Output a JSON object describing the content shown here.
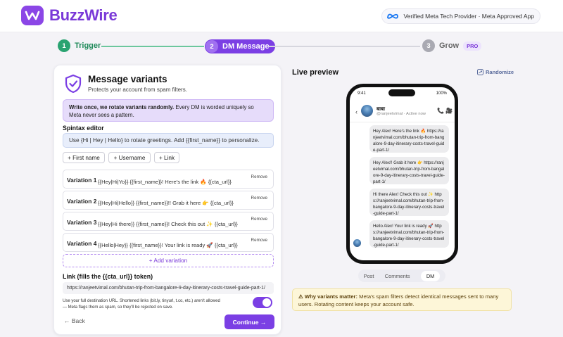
{
  "brand": {
    "name": "BuzzWire",
    "verified_text": "Verified Meta Tech Provider · Meta Approved App"
  },
  "steps": [
    {
      "num": "1",
      "label": "Trigger",
      "state": "done"
    },
    {
      "num": "2",
      "label": "DM Message",
      "state": "active"
    },
    {
      "num": "3",
      "label": "Grow",
      "state": "pending",
      "badge": "PRO"
    }
  ],
  "editor": {
    "title": "Message variants",
    "subtitle": "Protects your account from spam filters.",
    "info_bold": "Write once, we rotate variants randomly.",
    "info_rest": " Every DM is worded uniquely so Meta never sees a pattern.",
    "spintax_label": "Spintax editor",
    "spintax_value": "Use {Hi | Hey | Hello} to rotate greetings. Add {{first_name}} to personalize.",
    "tokens": [
      "+ First name",
      "+ Username",
      "+ Link"
    ],
    "variations": [
      {
        "label": "Variation 1",
        "text": "{{Hey|Hi|Yo}} {{first_name}}! Here's the link 🔥 {{cta_url}}",
        "remove": "Remove"
      },
      {
        "label": "Variation 2",
        "text": "{{Hey|Hi|Hello}} {{first_name}}!! Grab it here 👉 {{cta_url}}",
        "remove": "Remove"
      },
      {
        "label": "Variation 3",
        "text": "{{Hey|Hi there}} {{first_name}}! Check this out ✨ {{cta_url}}",
        "remove": "Remove"
      },
      {
        "label": "Variation 4",
        "text": "{{Hello|Hey}} {{first_name}}! Your link is ready 🚀 {{cta_url}}",
        "remove": "Remove"
      }
    ],
    "add_variation": "+ Add variation",
    "link_label": "Link (fills the {{cta_url}} token)",
    "link_value": "https://ranjeetvimal.com/bhutan-trip-from-bangalore-9-day-itinerary-costs-travel-guide-part-1/",
    "link_note": "Use your full destination URL. Shortened links (bit.ly, tinyurl, t.co, etc.) aren't allowed — Meta flags them as spam, so they'll be rejected on save.",
    "toggle_on": true,
    "back": "← Back",
    "continue": "Continue →"
  },
  "preview": {
    "title": "Live preview",
    "randomize": "Randomize",
    "time": "9:41",
    "battery": "100%",
    "contact_name": "बाबा",
    "contact_user": "@ranjeetvimal · Active now",
    "messages": [
      "Hey Alex! Here's the link 🔥 https://ranjeetvimal.com/bhutan-trip-from-bangalore-9-day-itinerary-costs-travel-guide-part-1/",
      "Hey Alex!! Grab it here 👉 https://ranjeetvimal.com/bhutan-trip-from-bangalore-9-day-itinerary-costs-travel-guide-part-1/",
      "Hi there Alex! Check this out ✨ https://ranjeetvimal.com/bhutan-trip-from-bangalore-9-day-itinerary-costs-travel-guide-part-1/",
      "Hello Alex! Your link is ready 🚀 https://ranjeetvimal.com/bhutan-trip-from-bangalore-9-day-itinerary-costs-travel-guide-part-1/"
    ],
    "tabs": [
      "Post",
      "Comments",
      "DM"
    ],
    "active_tab": "DM",
    "warn_bold": "⚠ Why variants matter:",
    "warn_rest": " Meta's spam filters detect identical messages sent to many users. Rotating content keeps your account safe."
  }
}
